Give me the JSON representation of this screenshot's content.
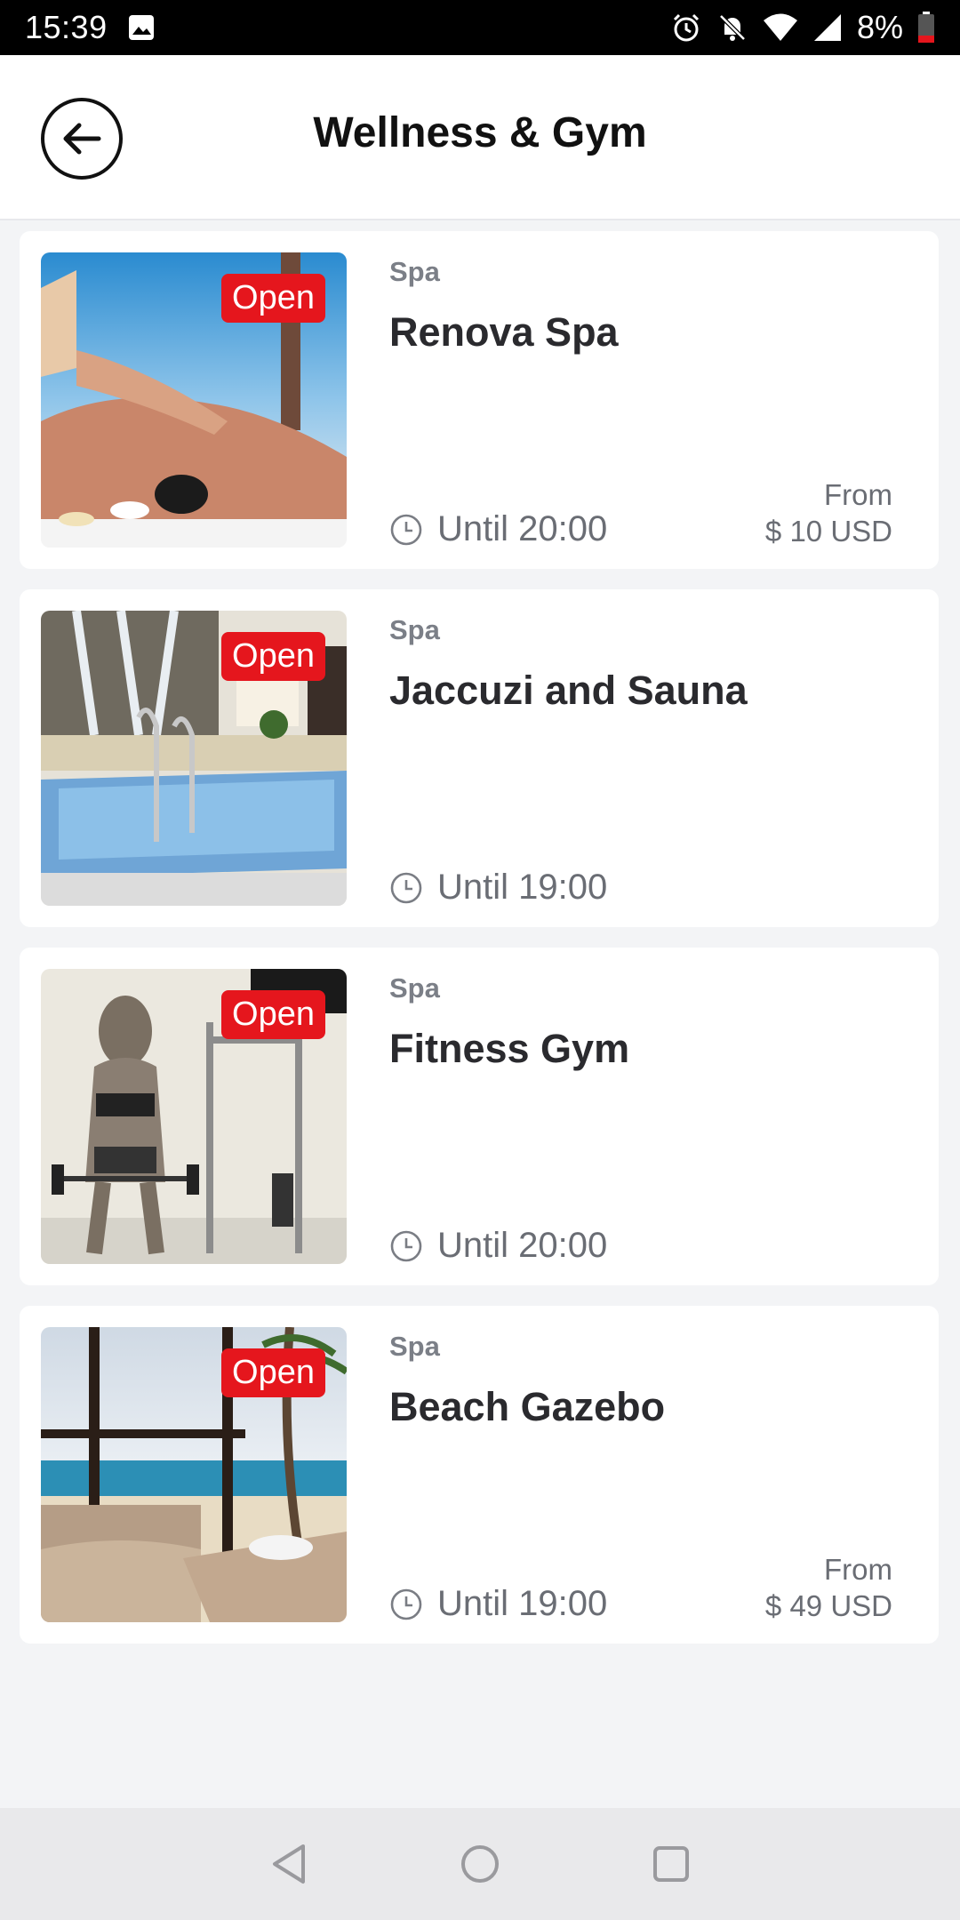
{
  "status_bar": {
    "time": "15:39",
    "battery_percent": "8%",
    "icons": [
      "image-icon",
      "alarm-icon",
      "notifications-off-icon",
      "wifi-icon",
      "signal-icon",
      "battery-icon"
    ]
  },
  "header": {
    "title": "Wellness & Gym",
    "back_icon": "arrow-left-icon"
  },
  "colors": {
    "badge": "#e5161d",
    "background": "#f3f4f6",
    "card": "#ffffff"
  },
  "items": [
    {
      "badge": "Open",
      "category": "Spa",
      "name": "Renova Spa",
      "hours": "Until 20:00",
      "price_label": "From",
      "price": "$ 10 USD",
      "image": "massage-photo"
    },
    {
      "badge": "Open",
      "category": "Spa",
      "name": "Jaccuzi and Sauna",
      "hours": "Until 19:00",
      "image": "pool-photo"
    },
    {
      "badge": "Open",
      "category": "Spa",
      "name": "Fitness Gym",
      "hours": "Until 20:00",
      "image": "gym-photo"
    },
    {
      "badge": "Open",
      "category": "Spa",
      "name": "Beach Gazebo",
      "hours": "Until 19:00",
      "price_label": "From",
      "price": "$ 49 USD",
      "image": "beach-gazebo-photo"
    }
  ],
  "nav_bar": {
    "icons": [
      "back-triangle-icon",
      "home-circle-icon",
      "recents-square-icon"
    ]
  }
}
